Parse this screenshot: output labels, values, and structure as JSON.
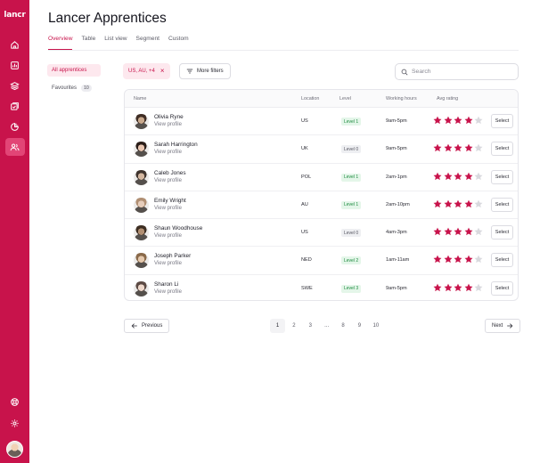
{
  "brand": {
    "logo": "lancr"
  },
  "page": {
    "title": "Lancer Apprentices"
  },
  "tabs": [
    "Overview",
    "Table",
    "List view",
    "Segment",
    "Custom"
  ],
  "left_menu": {
    "all_label": "All apprentices",
    "fav_label": "Favourites",
    "fav_count": "10"
  },
  "filters": {
    "chip_label": "US, AU, +4",
    "more_label": "More filters",
    "search_placeholder": "Search"
  },
  "table": {
    "headers": {
      "name": "Name",
      "location": "Location",
      "level": "Level",
      "hours": "Working hours",
      "rating": "Avg rating"
    },
    "view_profile": "View profile",
    "select_label": "Select",
    "rows": [
      {
        "name": "Olivia Ryne",
        "location": "US",
        "level": "Level 1",
        "level_style": "green",
        "hours": "9am-5pm",
        "rating": 4
      },
      {
        "name": "Sarah Harrington",
        "location": "UK",
        "level": "Level 0",
        "level_style": "gray",
        "hours": "9am-5pm",
        "rating": 4
      },
      {
        "name": "Caleb Jones",
        "location": "POL",
        "level": "Level 1",
        "level_style": "green",
        "hours": "2am-1pm",
        "rating": 4
      },
      {
        "name": "Emily Wright",
        "location": "AU",
        "level": "Level 1",
        "level_style": "green",
        "hours": "2am-10pm",
        "rating": 4
      },
      {
        "name": "Shaun Woodhouse",
        "location": "US",
        "level": "Level 0",
        "level_style": "gray",
        "hours": "4am-3pm",
        "rating": 4
      },
      {
        "name": "Joseph Parker",
        "location": "NED",
        "level": "Level 2",
        "level_style": "green",
        "hours": "1am-11am",
        "rating": 4
      },
      {
        "name": "Sharon Li",
        "location": "SWE",
        "level": "Level 3",
        "level_style": "green",
        "hours": "9am-5pm",
        "rating": 4
      }
    ]
  },
  "pagination": {
    "prev_label": "Previous",
    "next_label": "Next",
    "pages": [
      "1",
      "2",
      "3",
      "...",
      "8",
      "9",
      "10"
    ],
    "current": "1"
  },
  "colors": {
    "accent": "#c8134b",
    "star_empty": "#d9d9de"
  }
}
